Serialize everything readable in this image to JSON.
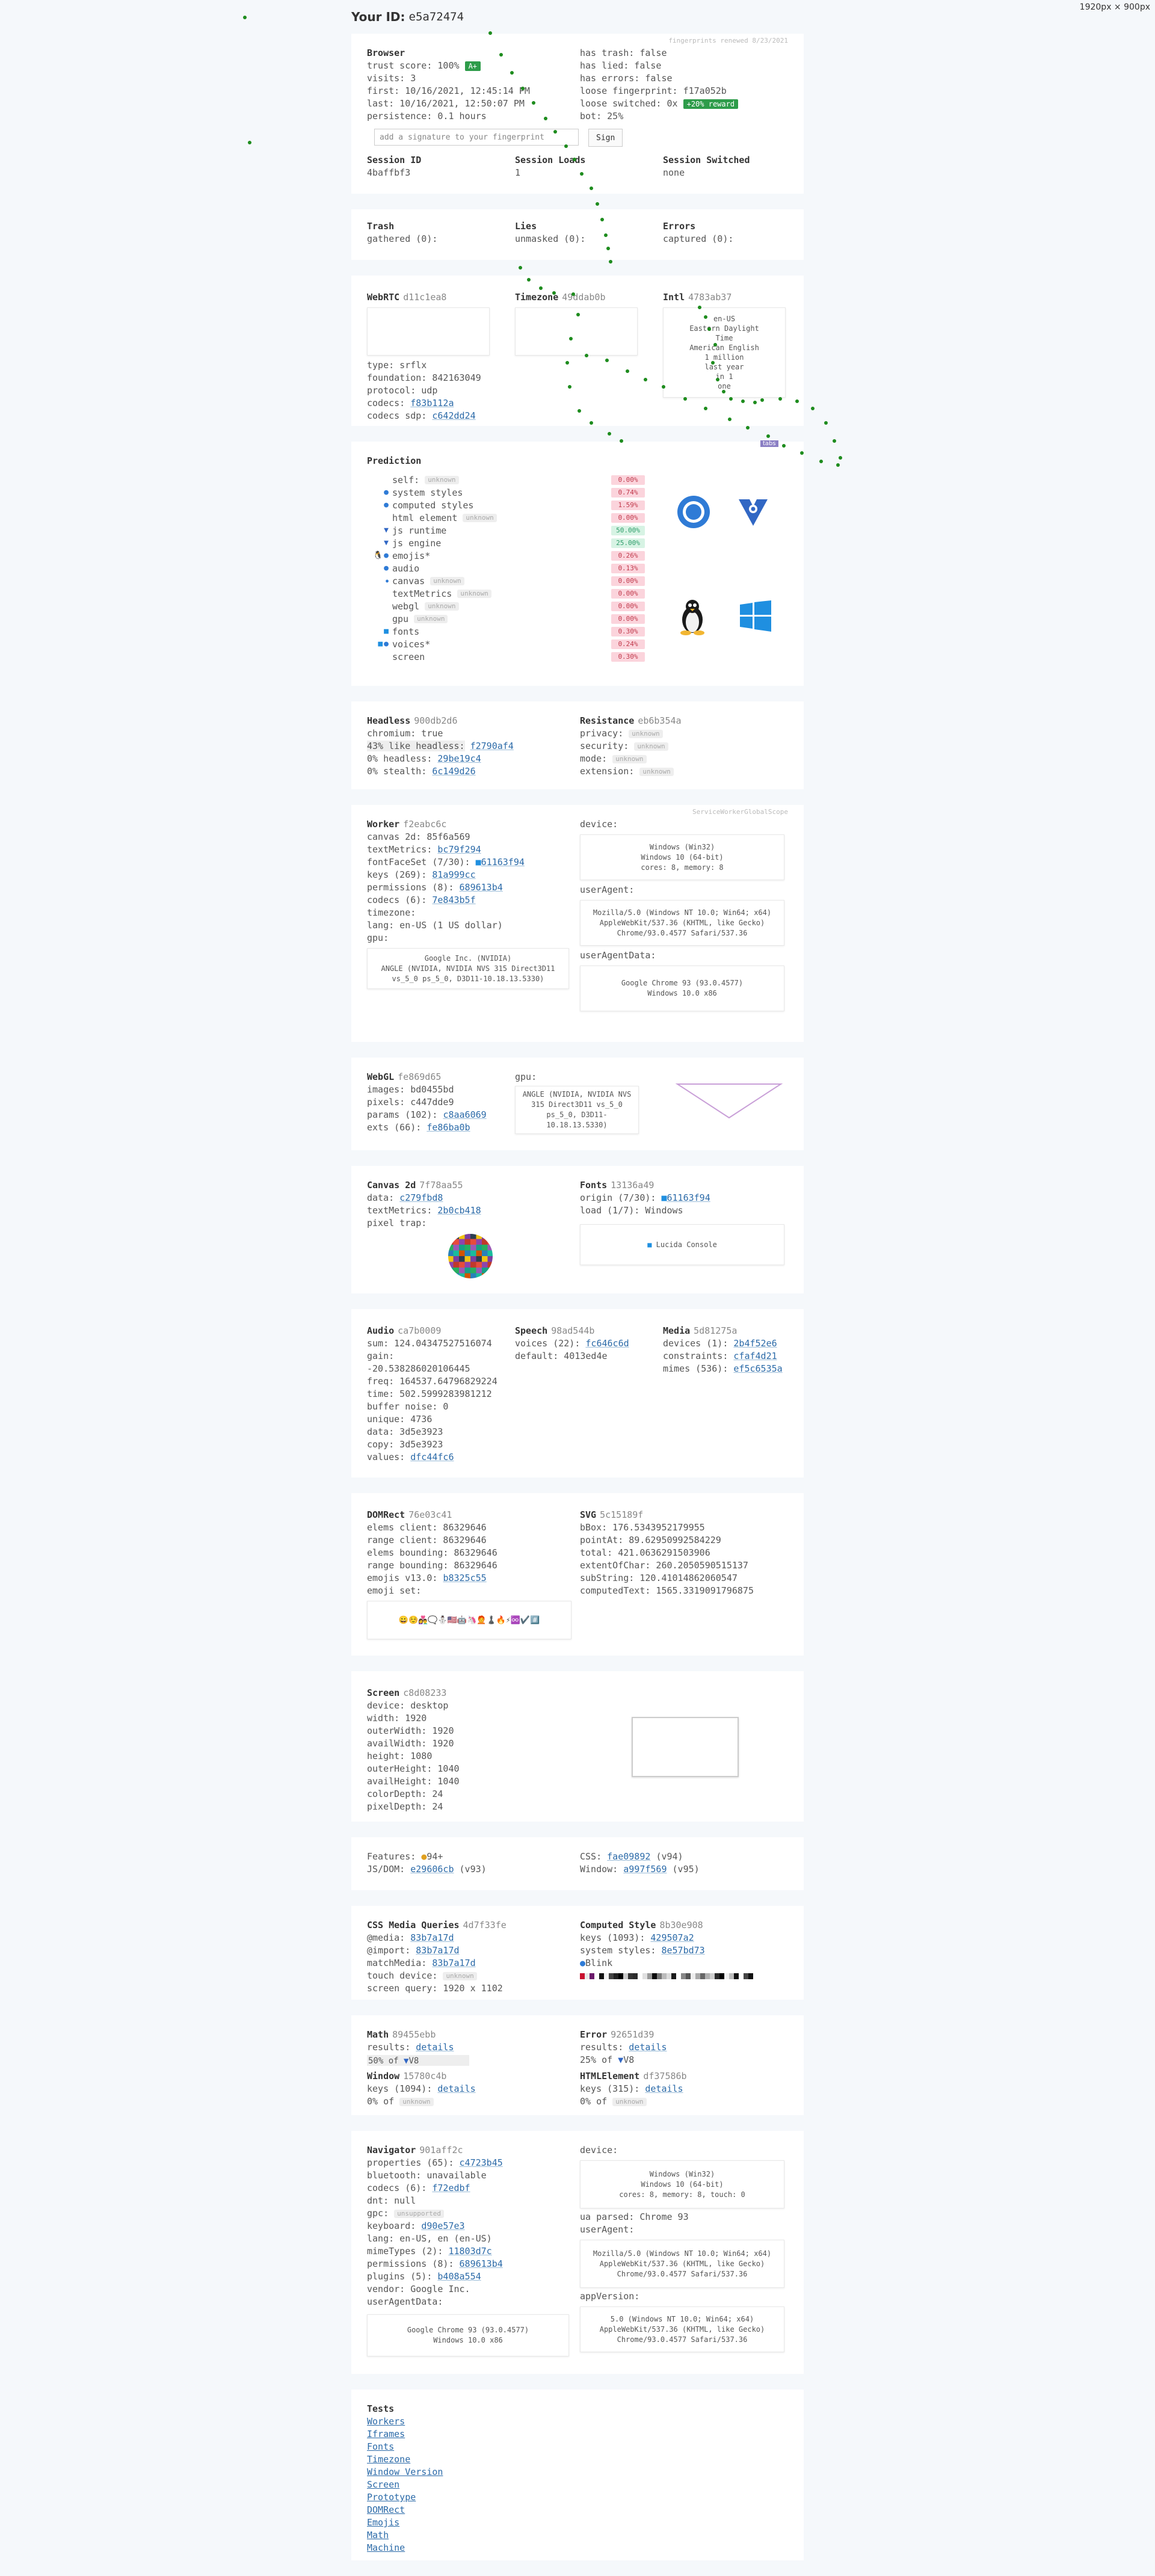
{
  "corner_dims": "1920px × 900px",
  "header": {
    "title": "Your ID:",
    "id": "e5a72474"
  },
  "browser": {
    "renewed": "fingerprints renewed 8/23/2021",
    "title": "Browser",
    "left": [
      "trust score: 100%",
      "visits: 3",
      "first: 10/16/2021, 12:45:14 PM",
      "last: 10/16/2021, 12:50:07 PM",
      "persistence: 0.1 hours"
    ],
    "trust_badge": "A+",
    "right": [
      "has trash: false",
      "has lied: false",
      "has errors: false",
      "loose fingerprint: f17a052b",
      "loose switched: 0x",
      "bot: 25%"
    ],
    "reward_badge": "+20% reward",
    "signature_placeholder": "add a signature to your fingerprint",
    "sign": "Sign",
    "session": [
      {
        "label": "Session ID",
        "value": "4baffbf3"
      },
      {
        "label": "Session Loads",
        "value": "1"
      },
      {
        "label": "Session Switched",
        "value": "none"
      }
    ]
  },
  "trash": [
    {
      "label": "Trash",
      "value": "gathered (0):"
    },
    {
      "label": "Lies",
      "value": "unmasked (0):"
    },
    {
      "label": "Errors",
      "value": "captured (0):"
    }
  ],
  "webrtc": {
    "title": "WebRTC",
    "hash": "d11c1ea8",
    "lines": [
      "type: srflx",
      "foundation: 842163049",
      "protocol: udp"
    ],
    "codecs_label": "codecs:",
    "codecs": "f83b112a",
    "codecs_sdp_label": "codecs sdp:",
    "codecs_sdp": "c642dd24",
    "tz_title": "Timezone",
    "tz_hash": "49ddab0b",
    "intl_title": "Intl",
    "intl_hash": "4783ab37",
    "intl_box": [
      "en-US",
      "Eastern Daylight",
      "Time",
      "American English",
      "1 million",
      "last year",
      "in 1",
      "one"
    ]
  },
  "prediction": {
    "title": "Prediction",
    "rows": [
      {
        "label": "self:",
        "tag": "unknown",
        "pct": "0.00%",
        "c": "r",
        "ico": ""
      },
      {
        "label": "system styles",
        "tag": "",
        "pct": "0.74%",
        "c": "r",
        "ico": "chrome"
      },
      {
        "label": "computed styles",
        "tag": "",
        "pct": "1.59%",
        "c": "r",
        "ico": "chrome"
      },
      {
        "label": "html element",
        "tag": "unknown",
        "pct": "0.00%",
        "c": "r",
        "ico": ""
      },
      {
        "label": "js runtime",
        "tag": "",
        "pct": "50.00%",
        "c": "g",
        "ico": "v8"
      },
      {
        "label": "js engine",
        "tag": "",
        "pct": "25.00%",
        "c": "g",
        "ico": "v8"
      },
      {
        "label": "emojis",
        "tag": "",
        "pct": "0.26%",
        "c": "r",
        "ico": "linux"
      },
      {
        "label": "audio",
        "tag": "",
        "pct": "0.13%",
        "c": "r",
        "ico": "chrome"
      },
      {
        "label": "canvas",
        "tag": "unknown",
        "pct": "0.00%",
        "c": "r",
        "ico": "dot"
      },
      {
        "label": "textMetrics",
        "tag": "unknown",
        "pct": "0.00%",
        "c": "r",
        "ico": ""
      },
      {
        "label": "webgl",
        "tag": "unknown",
        "pct": "0.00%",
        "c": "r",
        "ico": ""
      },
      {
        "label": "gpu",
        "tag": "unknown",
        "pct": "0.00%",
        "c": "r",
        "ico": ""
      },
      {
        "label": "fonts",
        "tag": "",
        "pct": "0.30%",
        "c": "r",
        "ico": "win"
      },
      {
        "label": "voices",
        "tag": "",
        "pct": "0.24%",
        "c": "r",
        "ico": "win"
      },
      {
        "label": "screen",
        "tag": "",
        "pct": "0.30%",
        "c": "r",
        "ico": ""
      }
    ]
  },
  "headless": {
    "title": "Headless",
    "hash": "900db2d6",
    "l1": "chromium: true",
    "l2": "43% like headless:",
    "l2h": "f2790af4",
    "l3": "0% headless:",
    "l3h": "29be19c4",
    "l4": "0% stealth:",
    "l4h": "6c149d26",
    "res_title": "Resistance",
    "res_hash": "eb6b354a",
    "res_rows": [
      "privacy:",
      "security:",
      "mode:",
      "extension:"
    ],
    "unknown": "unknown"
  },
  "worker": {
    "corner": "ServiceWorkerGlobalScope",
    "title": "Worker",
    "hash": "f2eabc6c",
    "lines": [
      {
        "k": "canvas 2d:",
        "v": "85f6a569"
      },
      {
        "k": "textMetrics:",
        "h": "bc79f294"
      },
      {
        "k": "fontFaceSet (7/30):",
        "h": "61163f94"
      },
      {
        "k": "keys (269):",
        "h": "81a999cc"
      },
      {
        "k": "permissions (8):",
        "h": "689613b4"
      },
      {
        "k": "codecs (6):",
        "h": "7e843b5f"
      },
      {
        "k": "timezone:",
        "v": ""
      },
      {
        "k": "lang: en-US (1 US dollar)",
        "v": ""
      },
      {
        "k": "gpu:",
        "v": ""
      }
    ],
    "gpu_box": "Google Inc. (NVIDIA)\nANGLE (NVIDIA, NVIDIA NVS 315 Direct3D11\nvs_5_0 ps_5_0, D3D11-10.18.13.5330)",
    "device_label": "device:",
    "device_box": "Windows (Win32)\nWindows 10 (64-bit)\ncores: 8, memory: 8",
    "ua_label": "userAgent:",
    "ua_box": "Mozilla/5.0 (Windows NT 10.0; Win64; x64)\nAppleWebKit/537.36 (KHTML, like Gecko)\nChrome/93.0.4577 Safari/537.36",
    "uad_label": "userAgentData:",
    "uad_box": "Google Chrome 93 (93.0.4577)\nWindows 10.0 x86"
  },
  "webgl": {
    "title": "WebGL",
    "hash": "fe869d65",
    "images": "images: bd0455bd",
    "pixels": "pixels: c447dde9",
    "params": "params (102):",
    "params_h": "c8aa6069",
    "exts": "exts (66):",
    "exts_h": "fe86ba0b",
    "gpu_label": "gpu:",
    "gpu_box": "ANGLE (NVIDIA, NVIDIA NVS\n315 Direct3D11 vs_5_0\nps_5_0, D3D11-\n10.18.13.5330)"
  },
  "canvas": {
    "title": "Canvas 2d",
    "hash": "7f78aa55",
    "data": "data:",
    "data_h": "c279fbd8",
    "tm": "textMetrics:",
    "tm_h": "2b0cb418",
    "trap": "pixel trap:",
    "fonts_title": "Fonts",
    "fonts_hash": "13136a49",
    "origin": "origin (7/30):",
    "origin_h": "61163f94",
    "load": "load (1/7): Windows",
    "font_box": "Lucida Console"
  },
  "audio": {
    "title": "Audio",
    "hash": "ca7b0009",
    "lines": [
      "sum: 124.04347527516074",
      "gain:",
      "-20.538286020106445",
      "freq: 164537.64796829224",
      "time: 502.5999283981212",
      "buffer noise: 0",
      "unique: 4736",
      "data: 3d5e3923",
      "copy: 3d5e3923"
    ],
    "values": "values:",
    "values_h": "dfc44fc6",
    "speech_title": "Speech",
    "speech_hash": "98ad544b",
    "voices": "voices (22):",
    "voices_h": "fc646c6d",
    "default": "default: 4013ed4e",
    "media_title": "Media",
    "media_hash": "5d81275a",
    "m1": "devices (1):",
    "m1h": "2b4f52e6",
    "m2": "constraints:",
    "m2h": "cfaf4d21",
    "m3": "mimes (536):",
    "m3h": "ef5c6535a"
  },
  "domrect": {
    "title": "DOMRect",
    "hash": "76e03c41",
    "lines": [
      "elems client: 86329646",
      "range client: 86329646",
      "elems bounding: 86329646",
      "range bounding: 86329646"
    ],
    "emojis": "emojis v13.0:",
    "emojis_h": "b8325c55",
    "set": "emoji set:",
    "emoji_box": "😀☺️👩‍❤️‍👨🗨️⛄🇺🇸🤖🦄🧑‍🦰♟️🔥⚡♾️✔️#️⃣",
    "svg_title": "SVG",
    "svg_hash": "5c15189f",
    "svg_lines": [
      "bBox: 176.5343952179955",
      "pointAt: 89.62950992584229",
      "total: 421.0636291503906",
      "extentOfChar: 260.2050590515137",
      "subString: 120.41014862060547",
      "computedText: 1565.3319091796875"
    ]
  },
  "screen": {
    "title": "Screen",
    "hash": "c8d08233",
    "lines": [
      "device: desktop",
      "width: 1920",
      "outerWidth: 1920",
      "availWidth: 1920",
      "height: 1080",
      "outerHeight: 1040",
      "availHeight: 1040",
      "colorDepth: 24",
      "pixelDepth: 24"
    ]
  },
  "features": {
    "f1": "Features:",
    "f1v": "94+",
    "f2": "JS/DOM:",
    "f2h": "e29606cb",
    "f2v": "(v93)",
    "f3": "CSS:",
    "f3h": "fae09892",
    "f3v": "(v94)",
    "f4": "Window:",
    "f4h": "a997f569",
    "f4v": "(v95)"
  },
  "cssmq": {
    "title": "CSS Media Queries",
    "hash": "4d7f33fe",
    "l": [
      {
        "k": "@media:",
        "h": "83b7a17d"
      },
      {
        "k": "@import:",
        "h": "83b7a17d"
      },
      {
        "k": "matchMedia:",
        "h": "83b7a17d"
      }
    ],
    "touch": "touch device:",
    "touch_tag": "unknown",
    "sq": "screen query: 1920 x 1102",
    "cs_title": "Computed Style",
    "cs_hash": "8b30e908",
    "keys": "keys (1093):",
    "keys_h": "429507a2",
    "ss": "system styles:",
    "ss_h": "8e57bd73",
    "blink": "Blink",
    "colors": [
      "#c8102e",
      "#e8e8e8",
      "#6b1a6b",
      "#ffffff",
      "#111111",
      "#f3f3f3",
      "#444444",
      "#222222",
      "#000000",
      "#cccccc",
      "#333333",
      "#2b2b2b",
      "#ffffff",
      "#e0e0e0",
      "#999999",
      "#0a0a0a",
      "#777777",
      "#bbbbbb",
      "#dddddd",
      "#1a1a1a",
      "#ffffff",
      "#888888",
      "#555555",
      "#eeeeee",
      "#aaaaaa",
      "#666666",
      "#b0b0b0",
      "#cfcfcf",
      "#2c2c2c",
      "#000000",
      "#f0f0f0",
      "#bdbdbd",
      "#121212",
      "#ffffff",
      "#454545",
      "#111111"
    ]
  },
  "math": {
    "title": "Math",
    "hash": "89455ebb",
    "results": "results:",
    "details": "details",
    "p50": "50% of",
    "v8": "V8",
    "err_title": "Error",
    "err_hash": "92651d39",
    "p25": "25% of",
    "win_title": "Window",
    "win_hash": "15780c4b",
    "wk": "keys (1094):",
    "p0": "0% of",
    "unknown": "unknown",
    "html_title": "HTMLElement",
    "html_hash": "df37586b",
    "hk": "keys (315):"
  },
  "navigator": {
    "title": "Navigator",
    "hash": "901aff2c",
    "lines": [
      {
        "k": "properties (65):",
        "h": "c4723b45"
      },
      {
        "k": "bluetooth: unavailable"
      },
      {
        "k": "codecs (6):",
        "h": "f72edbf"
      },
      {
        "k": "dnt: null"
      },
      {
        "k": "gpc:",
        "tag": "unsupported"
      },
      {
        "k": "keyboard:",
        "h": "d90e57e3"
      },
      {
        "k": "lang: en-US, en (en-US)"
      },
      {
        "k": "mimeTypes (2):",
        "h": "11803d7c"
      },
      {
        "k": "permissions (8):",
        "h": "689613b4"
      },
      {
        "k": "plugins (5):",
        "h": "b408a554"
      },
      {
        "k": "vendor: Google Inc."
      },
      {
        "k": "userAgentData:"
      }
    ],
    "uad_box": "Google Chrome 93 (93.0.4577)\nWindows 10.0 x86",
    "device_label": "device:",
    "device_box": "Windows (Win32)\nWindows 10 (64-bit)\ncores: 8, memory: 8, touch: 0",
    "ua_parsed": "ua parsed: Chrome 93",
    "ua_label": "userAgent:",
    "ua_box": "Mozilla/5.0 (Windows NT 10.0; Win64; x64)\nAppleWebKit/537.36 (KHTML, like Gecko)\nChrome/93.0.4577 Safari/537.36",
    "av_label": "appVersion:",
    "av_box": "5.0 (Windows NT 10.0; Win64; x64)\nAppleWebKit/537.36 (KHTML, like Gecko)\nChrome/93.0.4577 Safari/537.36"
  },
  "tests": {
    "title": "Tests",
    "links": [
      "Workers",
      "Iframes",
      "Fonts",
      "Timezone",
      "Window Version",
      "Screen",
      "Prototype",
      "DOMRect",
      "Emojis",
      "Math",
      "Machine"
    ]
  },
  "overlay_chip": "tabs"
}
